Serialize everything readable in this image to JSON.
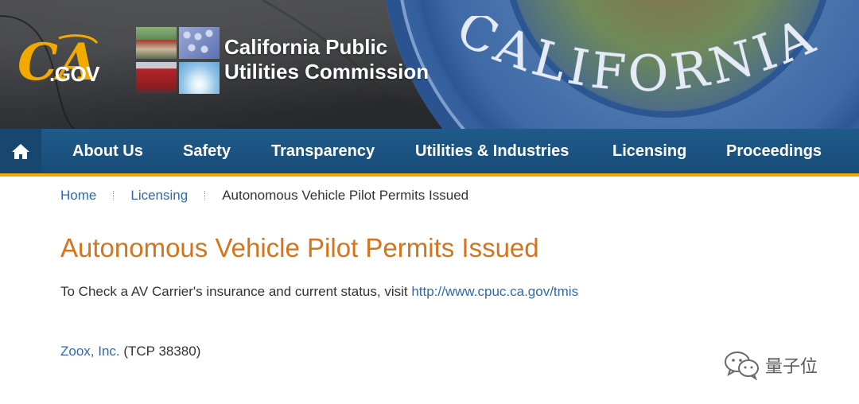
{
  "header": {
    "ca_logo": {
      "top": "CA",
      "bottom": ".GOV"
    },
    "agency_line1": "California Public",
    "agency_line2": "Utilities Commission",
    "seal_text": "CALIFORNIA"
  },
  "nav": {
    "home_icon": "home-icon",
    "items": [
      {
        "label": "About Us"
      },
      {
        "label": "Safety"
      },
      {
        "label": "Transparency"
      },
      {
        "label": "Utilities & Industries"
      },
      {
        "label": "Licensing"
      },
      {
        "label": "Proceedings"
      }
    ]
  },
  "breadcrumb": {
    "home": "Home",
    "section": "Licensing",
    "current": "Autonomous Vehicle Pilot Permits Issued"
  },
  "content": {
    "title": "Autonomous Vehicle Pilot Permits Issued",
    "intro_text": "To Check a AV Carrier's insurance and current status, visit ",
    "intro_link": "http://www.cpuc.ca.gov/tmis",
    "carrier_link": "Zoox, Inc.",
    "carrier_tcp": " (TCP 38380)"
  },
  "watermark": {
    "icon": "wechat-icon",
    "text": "量子位"
  },
  "colors": {
    "nav_bg": "#1f5a8a",
    "accent_gold": "#f2a900",
    "title_orange": "#d6731d",
    "link_blue": "#2e6ab1"
  }
}
